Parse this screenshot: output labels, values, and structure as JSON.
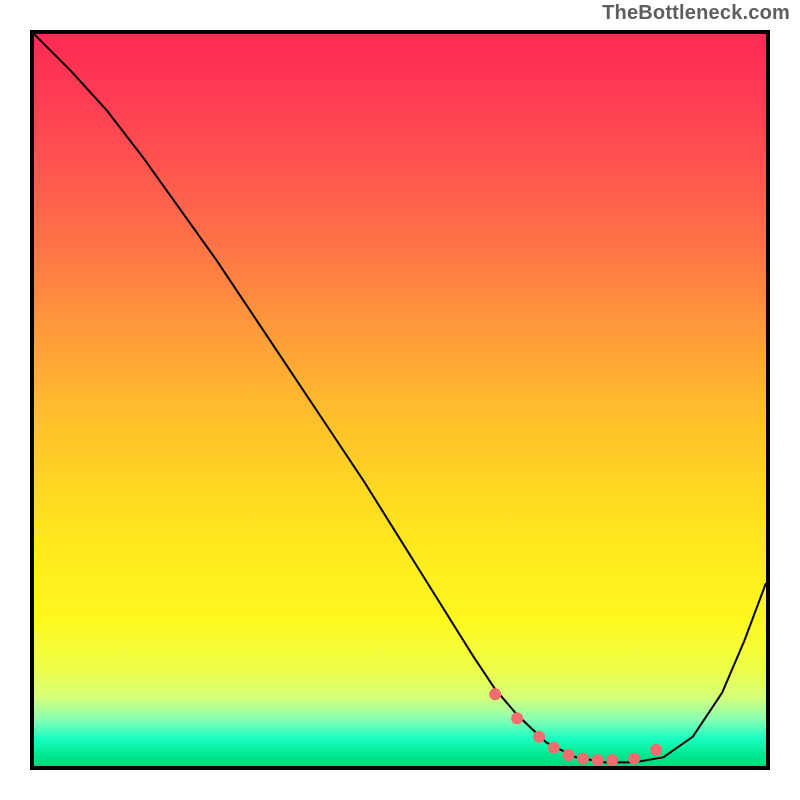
{
  "watermark": "TheBottleneck.com",
  "chart_data": {
    "type": "line",
    "title": "",
    "xlabel": "",
    "ylabel": "",
    "xlim": [
      0,
      100
    ],
    "ylim": [
      0,
      100
    ],
    "grid": false,
    "legend": false,
    "background_gradient": {
      "stops": [
        {
          "offset": 0.0,
          "color": "#ff2a55"
        },
        {
          "offset": 0.1,
          "color": "#ff3f53"
        },
        {
          "offset": 0.2,
          "color": "#ff5a4e"
        },
        {
          "offset": 0.3,
          "color": "#ff7745"
        },
        {
          "offset": 0.4,
          "color": "#ff983b"
        },
        {
          "offset": 0.5,
          "color": "#ffb92f"
        },
        {
          "offset": 0.6,
          "color": "#ffd223"
        },
        {
          "offset": 0.7,
          "color": "#ffe91e"
        },
        {
          "offset": 0.8,
          "color": "#fff81f"
        },
        {
          "offset": 0.87,
          "color": "#ecff4a"
        },
        {
          "offset": 0.905,
          "color": "#d6ff78"
        },
        {
          "offset": 0.935,
          "color": "#8dffb0"
        },
        {
          "offset": 0.962,
          "color": "#1cffc2"
        },
        {
          "offset": 0.985,
          "color": "#00e890"
        },
        {
          "offset": 1.0,
          "color": "#00d87c"
        }
      ]
    },
    "series": [
      {
        "name": "bottleneck-curve",
        "color": "#000000",
        "x": [
          0,
          5,
          10,
          15,
          20,
          25,
          30,
          35,
          40,
          45,
          50,
          55,
          60,
          63,
          66,
          70,
          74,
          78,
          82,
          86,
          90,
          94,
          97,
          100
        ],
        "y": [
          100,
          95,
          89.5,
          83,
          76,
          69,
          61.5,
          54,
          46.5,
          39,
          31,
          23,
          15,
          10.5,
          7,
          3.2,
          1.2,
          0.5,
          0.5,
          1.2,
          4,
          10,
          17,
          25
        ]
      },
      {
        "name": "floor-markers",
        "color": "#f26d6d",
        "type": "scatter",
        "x": [
          63,
          66,
          69,
          71,
          73,
          75,
          77,
          79,
          82,
          85
        ],
        "y": [
          9.8,
          6.5,
          4,
          2.5,
          1.5,
          1,
          0.8,
          0.8,
          1,
          2.2
        ]
      }
    ]
  }
}
